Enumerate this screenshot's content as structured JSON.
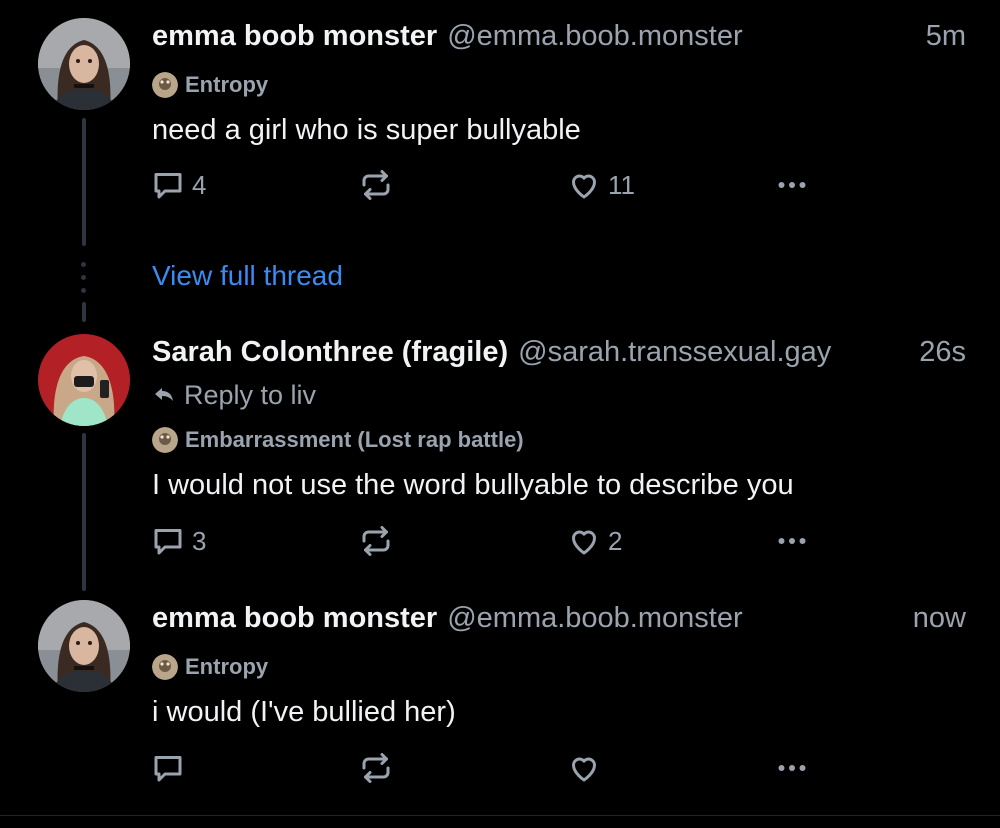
{
  "posts": [
    {
      "display_name": "emma boob monster",
      "handle": "@emma.boob.monster",
      "time": "5m",
      "label": "Entropy",
      "text": "need a girl who is super bullyable",
      "replies": "4",
      "likes": "11"
    },
    {
      "display_name": "Sarah Colonthree (fragile)",
      "handle": "@sarah.transsexual.gay",
      "time": "26s",
      "reply_to": "Reply to liv",
      "label": "Embarrassment (Lost rap battle)",
      "text": "I would not use the word bullyable to describe you",
      "replies": "3",
      "likes": "2"
    },
    {
      "display_name": "emma boob monster",
      "handle": "@emma.boob.monster",
      "time": "now",
      "label": "Entropy",
      "text": "i would (I've bullied her)",
      "replies": "",
      "likes": ""
    }
  ],
  "view_full_thread": "View full thread",
  "icons": {
    "reply": "speech-bubble-icon",
    "repost": "repost-arrows-icon",
    "like": "heart-icon",
    "more": "ellipsis-icon",
    "reply_to": "reply-arrow-icon"
  },
  "colors": {
    "background": "#000000",
    "text": "#f1f3f5",
    "muted": "#9aa3ae",
    "link": "#3b8cf2",
    "thread_line": "#2e3540"
  }
}
